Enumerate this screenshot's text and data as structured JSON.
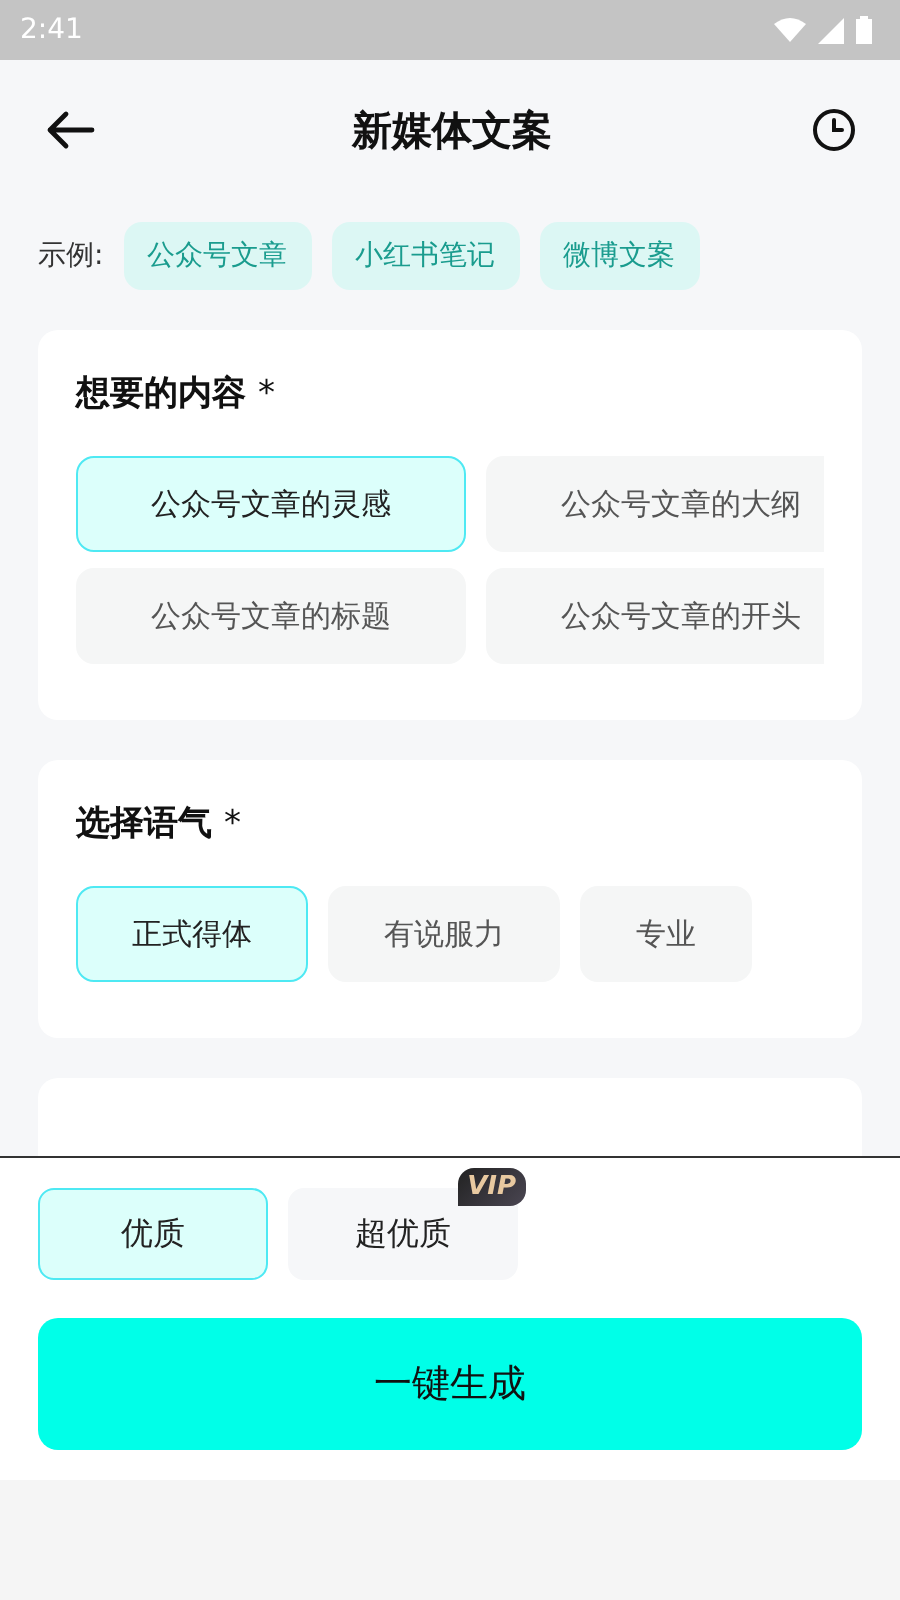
{
  "status_bar": {
    "time": "2:41"
  },
  "header": {
    "title": "新媒体文案"
  },
  "examples": {
    "label": "示例:",
    "tags": [
      "公众号文章",
      "小红书笔记",
      "微博文案"
    ]
  },
  "sections": [
    {
      "title": "想要的内容",
      "required_mark": "*",
      "kind": "grid",
      "options": [
        {
          "label": "公众号文章的灵感",
          "selected": true
        },
        {
          "label": "公众号文章的大纲",
          "selected": false
        },
        {
          "label": "公众号文章的标题",
          "selected": false
        },
        {
          "label": "公众号文章的开头",
          "selected": false
        }
      ]
    },
    {
      "title": "选择语气",
      "required_mark": "*",
      "kind": "row",
      "options": [
        {
          "label": "正式得体",
          "selected": true
        },
        {
          "label": "有说服力",
          "selected": false
        },
        {
          "label": "专业",
          "selected": false
        }
      ]
    }
  ],
  "quality": [
    {
      "label": "优质",
      "selected": true
    },
    {
      "label": "超优质",
      "selected": false,
      "badge": "VIP"
    }
  ],
  "generate_button": "一键生成"
}
